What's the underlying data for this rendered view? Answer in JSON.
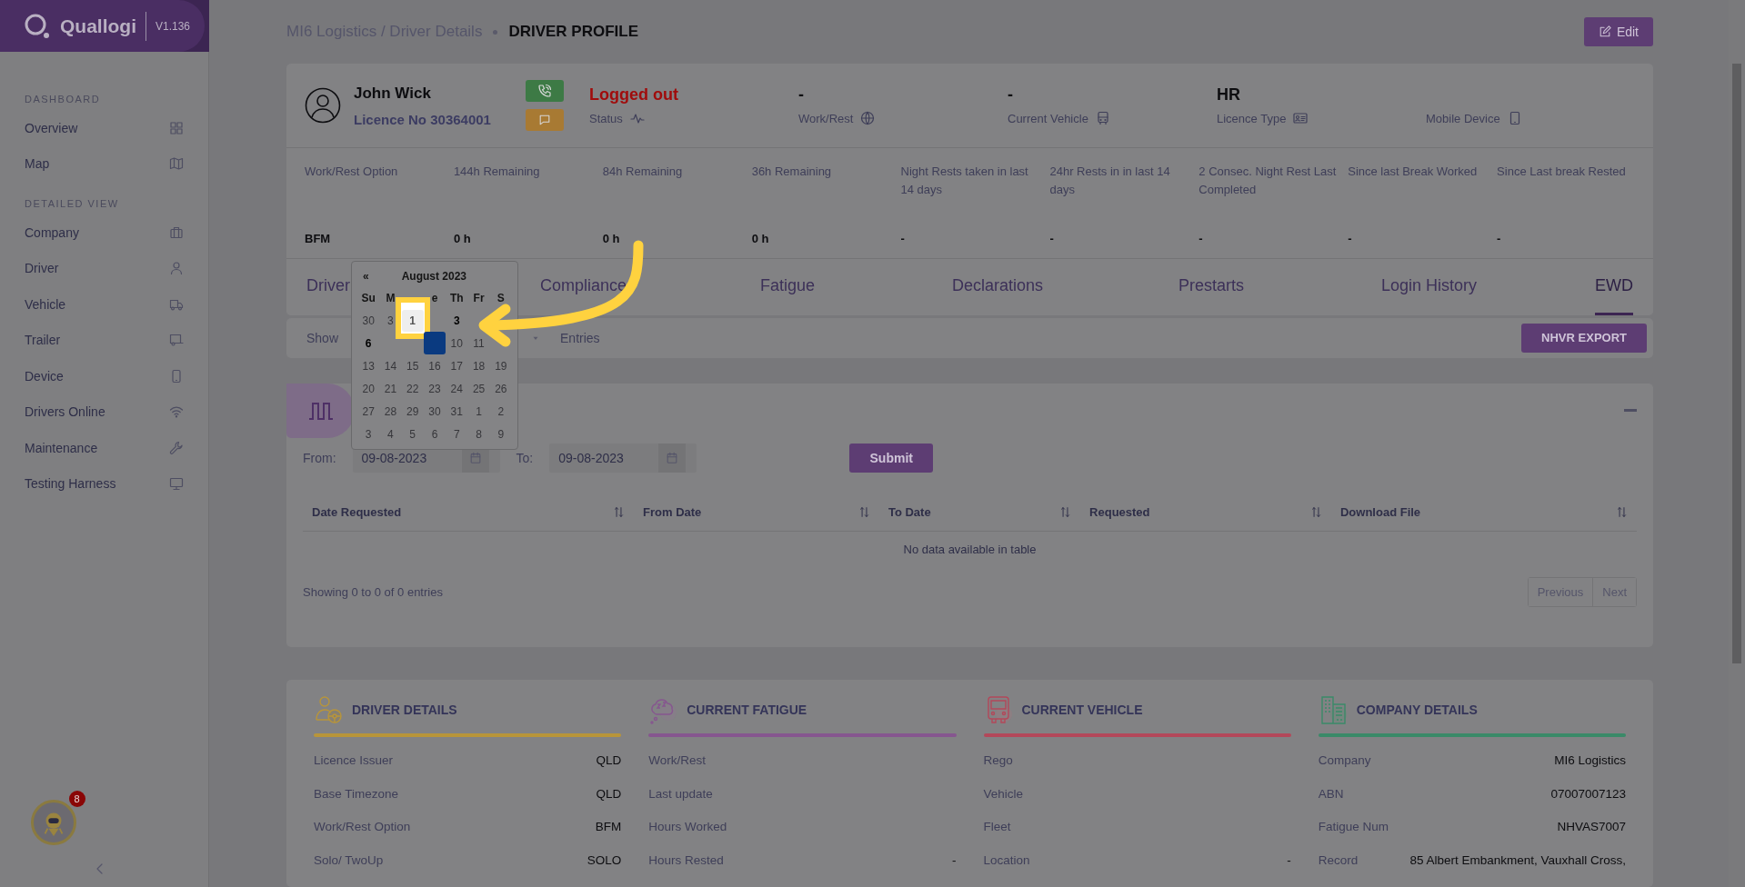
{
  "sidebar": {
    "brand": "Quallogi",
    "version": "V1.136",
    "sections": [
      {
        "heading": "DASHBOARD",
        "items": [
          {
            "label": "Overview"
          },
          {
            "label": "Map"
          }
        ]
      },
      {
        "heading": "DETAILED VIEW",
        "items": [
          {
            "label": "Company"
          },
          {
            "label": "Driver"
          },
          {
            "label": "Vehicle"
          },
          {
            "label": "Trailer"
          },
          {
            "label": "Device"
          },
          {
            "label": "Drivers Online"
          },
          {
            "label": "Maintenance"
          },
          {
            "label": "Testing Harness"
          }
        ]
      }
    ],
    "notification_count": "8"
  },
  "breadcrumb": {
    "path": "MI6 Logistics / Driver Details",
    "current": "DRIVER PROFILE"
  },
  "edit_button": "Edit",
  "driver": {
    "name": "John Wick",
    "licence": "Licence No 30364001"
  },
  "status_fields": [
    {
      "value": "Logged out",
      "label": "Status",
      "alert": true
    },
    {
      "value": "-",
      "label": "Work/Rest",
      "alert": false
    },
    {
      "value": "-",
      "label": "Current Vehicle",
      "alert": false
    },
    {
      "value": "HR",
      "label": "Licence Type",
      "alert": false
    },
    {
      "label": "Mobile Device"
    }
  ],
  "fatigue_table": {
    "columns": [
      "Work/Rest Option",
      "144h Remaining",
      "84h Remaining",
      "36h Remaining",
      "Night Rests taken in last 14 days",
      "24hr Rests in in last 14 days",
      "2 Consec. Night Rest Last Completed",
      "Since last Break Worked",
      "Since Last break Rested"
    ],
    "values": [
      "BFM",
      "0 h",
      "0 h",
      "0 h",
      "-",
      "-",
      "-",
      "-",
      "-"
    ]
  },
  "tabs": [
    {
      "label": "Driver",
      "selected": false
    },
    {
      "label": "Compliance",
      "selected": false
    },
    {
      "label": "Fatigue",
      "selected": false
    },
    {
      "label": "Declarations",
      "selected": false
    },
    {
      "label": "Prestarts",
      "selected": false
    },
    {
      "label": "Login History",
      "selected": false
    },
    {
      "label": "EWD",
      "selected": true
    }
  ],
  "entries": {
    "show_label": "Show",
    "entries_label": "Entries"
  },
  "export_button": "NHVR EXPORT",
  "ewd": {
    "from_label": "From:",
    "from_value": "09-08-2023",
    "to_label": "To:",
    "to_value": "09-08-2023",
    "submit": "Submit",
    "columns": [
      "Date Requested",
      "From Date",
      "To Date",
      "Requested",
      "Download File"
    ],
    "empty_message": "No data available in table",
    "info": "Showing 0 to 0 of 0 entries",
    "pagination": [
      "Previous",
      "Next"
    ]
  },
  "calendar": {
    "prev": "«",
    "month": "August 2023",
    "weekdays": [
      {
        "label": "Su"
      },
      {
        "label": "M"
      },
      {
        "covered": true
      },
      {
        "label": "e"
      },
      {
        "label": "Th"
      },
      {
        "label": "Fr"
      },
      {
        "label": "S"
      }
    ],
    "weeks": [
      [
        {
          "day": "30",
          "disabled": true
        },
        {
          "day": "3",
          "disabled": true
        },
        {
          "day": "1",
          "disabled": false,
          "focused": true
        },
        {
          "covered": true
        },
        {
          "day": "3",
          "disabled": false
        },
        {
          "covered": true
        },
        {
          "covered": true
        }
      ],
      [
        {
          "day": "6",
          "disabled": false
        },
        {
          "covered": true
        },
        {
          "covered": true
        },
        {
          "selected": true
        },
        {
          "day": "10",
          "disabled": true
        },
        {
          "day": "11",
          "disabled": true
        },
        {
          "covered": true
        }
      ],
      [
        {
          "day": "13",
          "disabled": true
        },
        {
          "day": "14",
          "disabled": true
        },
        {
          "day": "15",
          "disabled": true
        },
        {
          "day": "16",
          "disabled": true
        },
        {
          "day": "17",
          "disabled": true
        },
        {
          "day": "18",
          "disabled": true
        },
        {
          "day": "19",
          "disabled": true
        }
      ],
      [
        {
          "day": "20",
          "disabled": true
        },
        {
          "day": "21",
          "disabled": true
        },
        {
          "day": "22",
          "disabled": true
        },
        {
          "day": "23",
          "disabled": true
        },
        {
          "day": "24",
          "disabled": true
        },
        {
          "day": "25",
          "disabled": true
        },
        {
          "day": "26",
          "disabled": true
        }
      ],
      [
        {
          "day": "27",
          "disabled": true
        },
        {
          "day": "28",
          "disabled": true
        },
        {
          "day": "29",
          "disabled": true
        },
        {
          "day": "30",
          "disabled": true
        },
        {
          "day": "31",
          "disabled": true
        },
        {
          "day": "1",
          "disabled": true
        },
        {
          "day": "2",
          "disabled": true
        }
      ],
      [
        {
          "day": "3",
          "disabled": true
        },
        {
          "day": "4",
          "disabled": true
        },
        {
          "day": "5",
          "disabled": true
        },
        {
          "day": "6",
          "disabled": true
        },
        {
          "day": "7",
          "disabled": true
        },
        {
          "day": "8",
          "disabled": true
        },
        {
          "day": "9",
          "disabled": true
        }
      ]
    ]
  },
  "detail_sections": [
    {
      "title": "DRIVER DETAILS",
      "color": "#b8953a",
      "rows": [
        {
          "label": "Licence Issuer",
          "value": "QLD"
        },
        {
          "label": "Base Timezone",
          "value": "QLD"
        },
        {
          "label": "Work/Rest Option",
          "value": "BFM"
        },
        {
          "label": "Solo/ TwoUp",
          "value": "SOLO"
        }
      ]
    },
    {
      "title": "CURRENT FATIGUE",
      "color": "#86568f",
      "rows": [
        {
          "label": "Work/Rest"
        },
        {
          "label": "Last update"
        },
        {
          "label": "Hours Worked"
        },
        {
          "label": "Hours Rested",
          "value": "-"
        }
      ]
    },
    {
      "title": "CURRENT VEHICLE",
      "color": "#b3485a",
      "rows": [
        {
          "label": "Rego"
        },
        {
          "label": "Vehicle"
        },
        {
          "label": "Fleet"
        },
        {
          "label": "Location",
          "value": "-"
        }
      ]
    },
    {
      "title": "COMPANY DETAILS",
      "color": "#3a8a68",
      "rows": [
        {
          "label": "Company",
          "value": "MI6 Logistics"
        },
        {
          "label": "ABN",
          "value": "07007007123"
        },
        {
          "label": "Fatigue Num",
          "value": "NHVAS7007"
        },
        {
          "label": "Record",
          "value": "85 Albert Embankment, Vauxhall Cross,"
        }
      ]
    }
  ]
}
